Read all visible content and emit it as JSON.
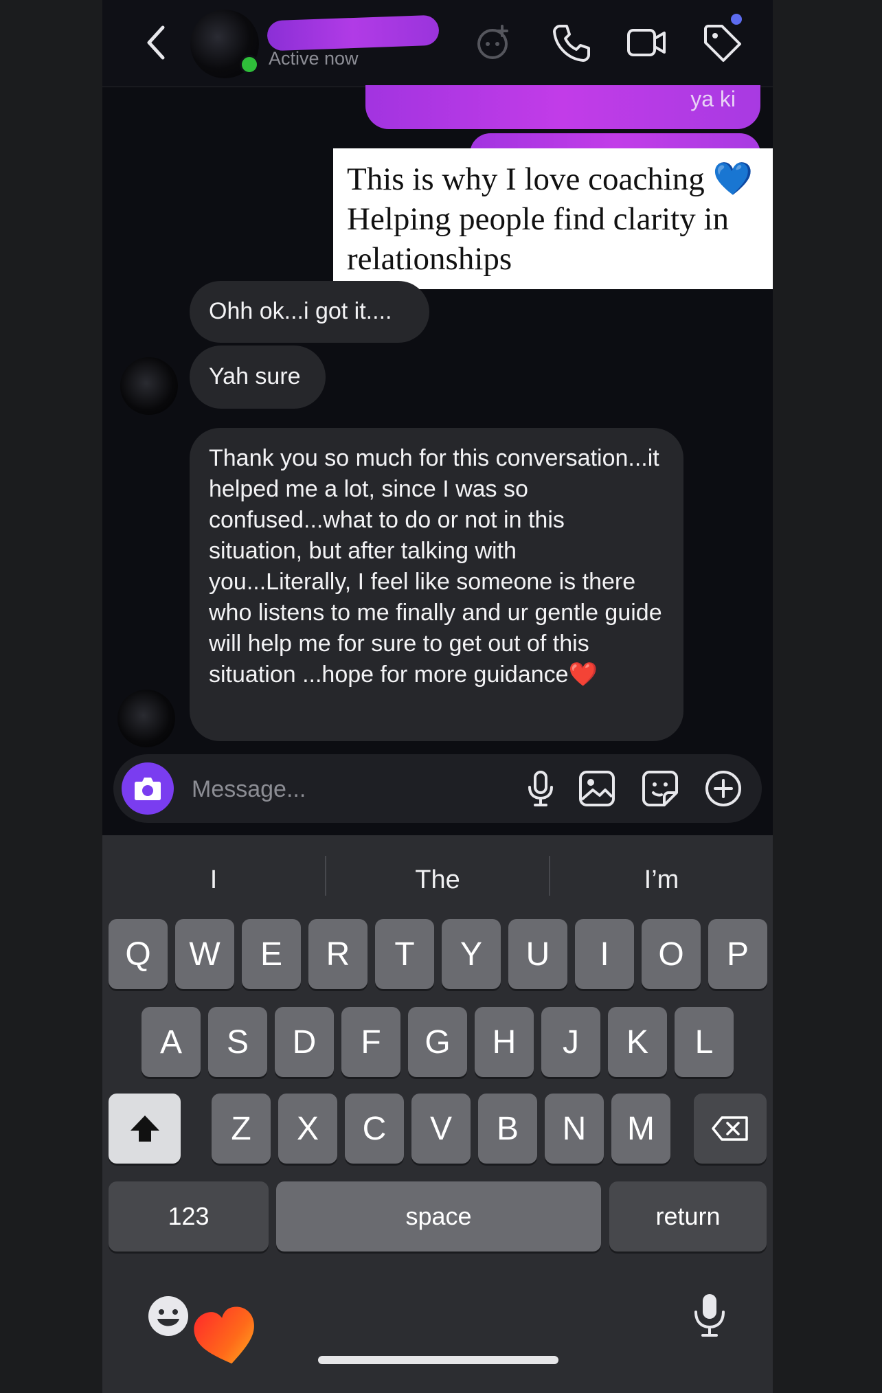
{
  "header": {
    "active_status": "Active now",
    "back_icon": "chevron-left-icon",
    "ai_icon": "ai-sparkle-icon",
    "call_icon": "phone-icon",
    "video_icon": "video-camera-icon",
    "tag_icon": "tag-icon",
    "tag_badge_color": "#5d6cf0"
  },
  "chat": {
    "sent_redacted_text": "ya ki",
    "caption_lines": {
      "line1": "This is why I love coaching ",
      "line1_emoji": "💙",
      "line2": "Helping people find clarity in",
      "line3": "relationships"
    },
    "messages": [
      {
        "text": "Ohh ok...i got it...."
      },
      {
        "text": "Yah sure"
      },
      {
        "text": "Thank you so much for this conversation...it helped me a lot, since I was so confused...what to do or not in this situation, but after talking with you...Literally, I feel like someone is there who listens to me finally and ur gentle guide will help me for sure to get out of this situation ...hope for more guidance",
        "emoji": "❤️"
      }
    ]
  },
  "composer": {
    "placeholder": "Message...",
    "camera_icon": "camera-icon",
    "mic_icon": "microphone-icon",
    "gallery_icon": "gallery-icon",
    "sticker_icon": "sticker-icon",
    "plus_icon": "plus-circle-icon",
    "accent_color": "#7a3df0"
  },
  "keyboard": {
    "suggestions": [
      "I",
      "The",
      "I’m"
    ],
    "row1": [
      "Q",
      "W",
      "E",
      "R",
      "T",
      "Y",
      "U",
      "I",
      "O",
      "P"
    ],
    "row2": [
      "A",
      "S",
      "D",
      "F",
      "G",
      "H",
      "J",
      "K",
      "L"
    ],
    "row3": [
      "Z",
      "X",
      "C",
      "V",
      "B",
      "N",
      "M"
    ],
    "numbers_label": "123",
    "space_label": "space",
    "return_label": "return",
    "shift_icon": "shift-arrow-icon",
    "backspace_icon": "backspace-icon",
    "emoji_icon": "emoji-face-icon",
    "dictation_icon": "microphone-icon"
  }
}
